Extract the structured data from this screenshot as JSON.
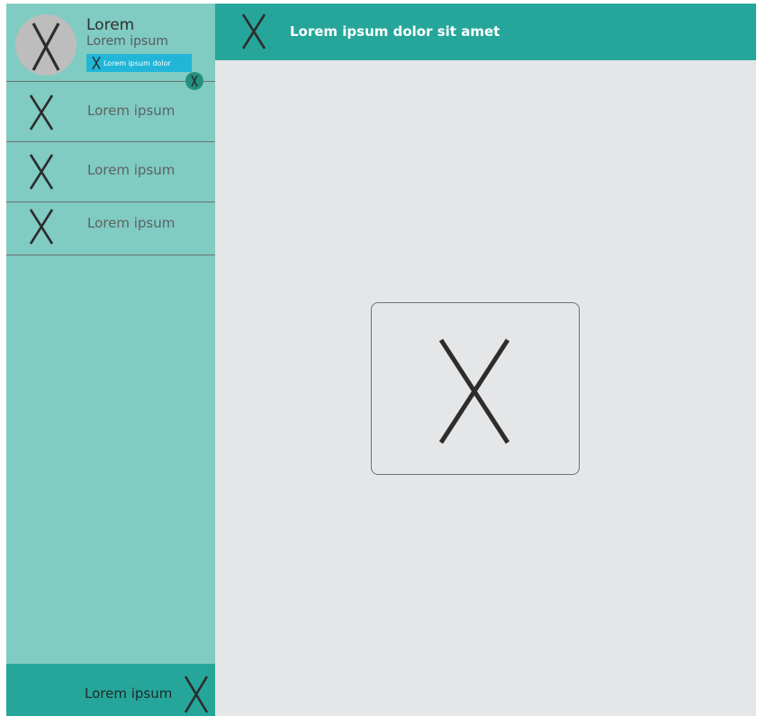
{
  "profile": {
    "name": "Lorem",
    "subtitle": "Lorem ipsum",
    "badge_label": "Lorem ipsum dolor",
    "avatar_icon": "x-placeholder-icon",
    "badge_icon": "x-placeholder-icon",
    "status_dot_icon": "x-placeholder-icon"
  },
  "sidebar": {
    "items": [
      {
        "label": "Lorem ipsum",
        "icon": "x-placeholder-icon"
      },
      {
        "label": "Lorem ipsum",
        "icon": "x-placeholder-icon"
      },
      {
        "label": "Lorem ipsum",
        "icon": "x-placeholder-icon"
      }
    ],
    "footer": {
      "label": "Lorem ipsum",
      "icon": "x-placeholder-icon"
    }
  },
  "header": {
    "title": "Lorem ipsum dolor sit amet",
    "icon": "x-placeholder-icon"
  },
  "main": {
    "placeholder_icon": "x-placeholder-icon"
  },
  "colors": {
    "sidebar_bg": "#80cbc2",
    "accent": "#26a69a",
    "badge": "#21b6d7",
    "content_bg": "#e5e6e7"
  }
}
